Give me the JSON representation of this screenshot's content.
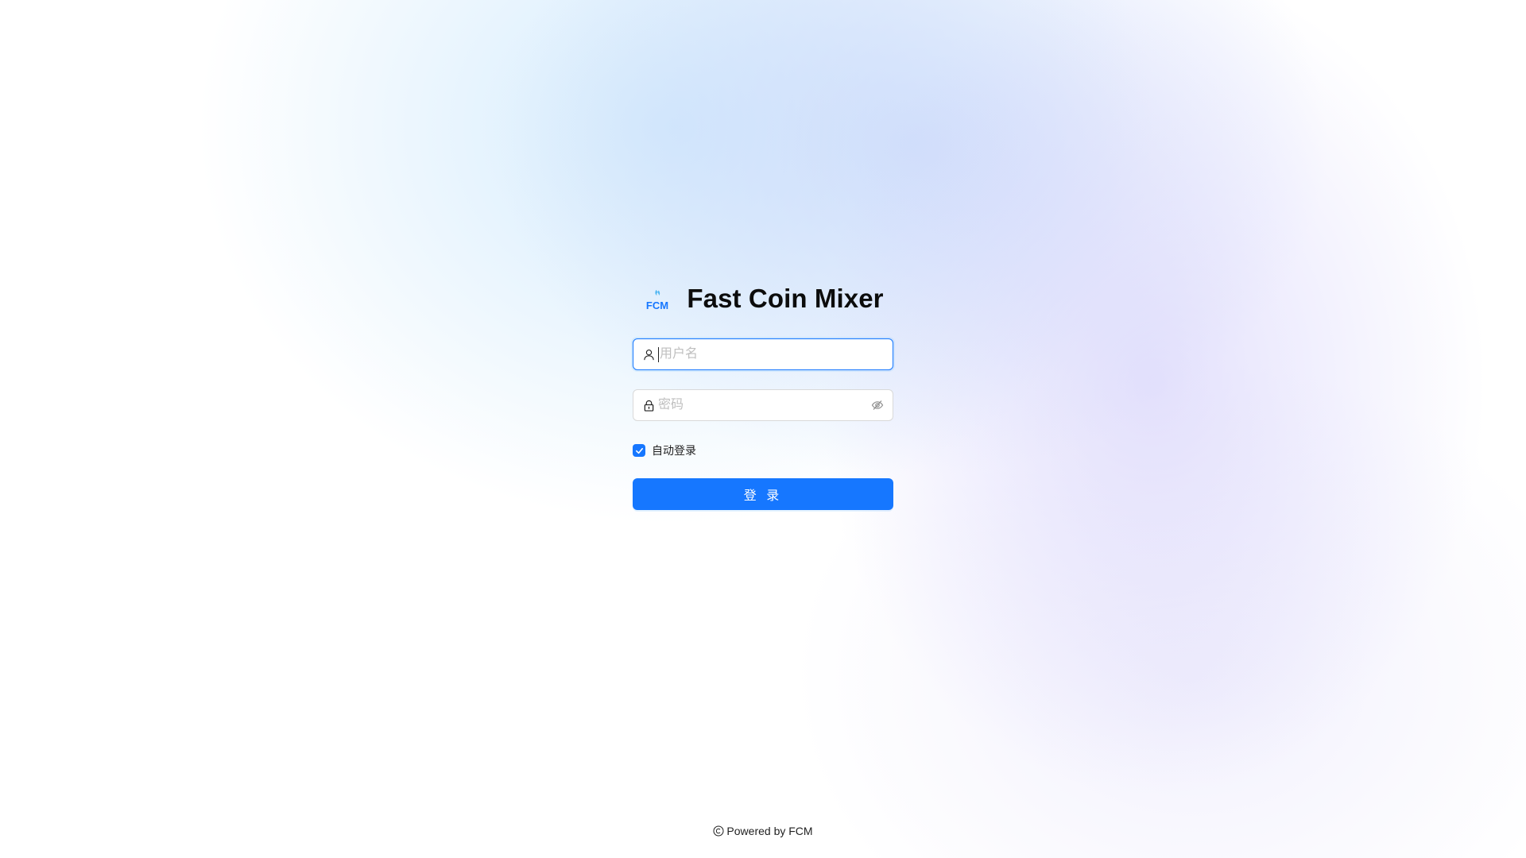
{
  "brand": {
    "logo_text": "FCM",
    "title": "Fast Coin Mixer"
  },
  "form": {
    "username": {
      "placeholder": "用户名",
      "value": "",
      "icon": "user-icon"
    },
    "password": {
      "placeholder": "密码",
      "value": "",
      "icon": "lock-icon",
      "toggle_icon": "eye-invisible-icon"
    },
    "remember": {
      "label": "自动登录",
      "checked": true
    },
    "submit_label": "登 录"
  },
  "footer": {
    "icon": "copyright-icon",
    "text": "Powered by FCM"
  },
  "colors": {
    "primary": "#1677ff",
    "title": "#0c0c0c",
    "placeholder": "#bfbfbf"
  }
}
